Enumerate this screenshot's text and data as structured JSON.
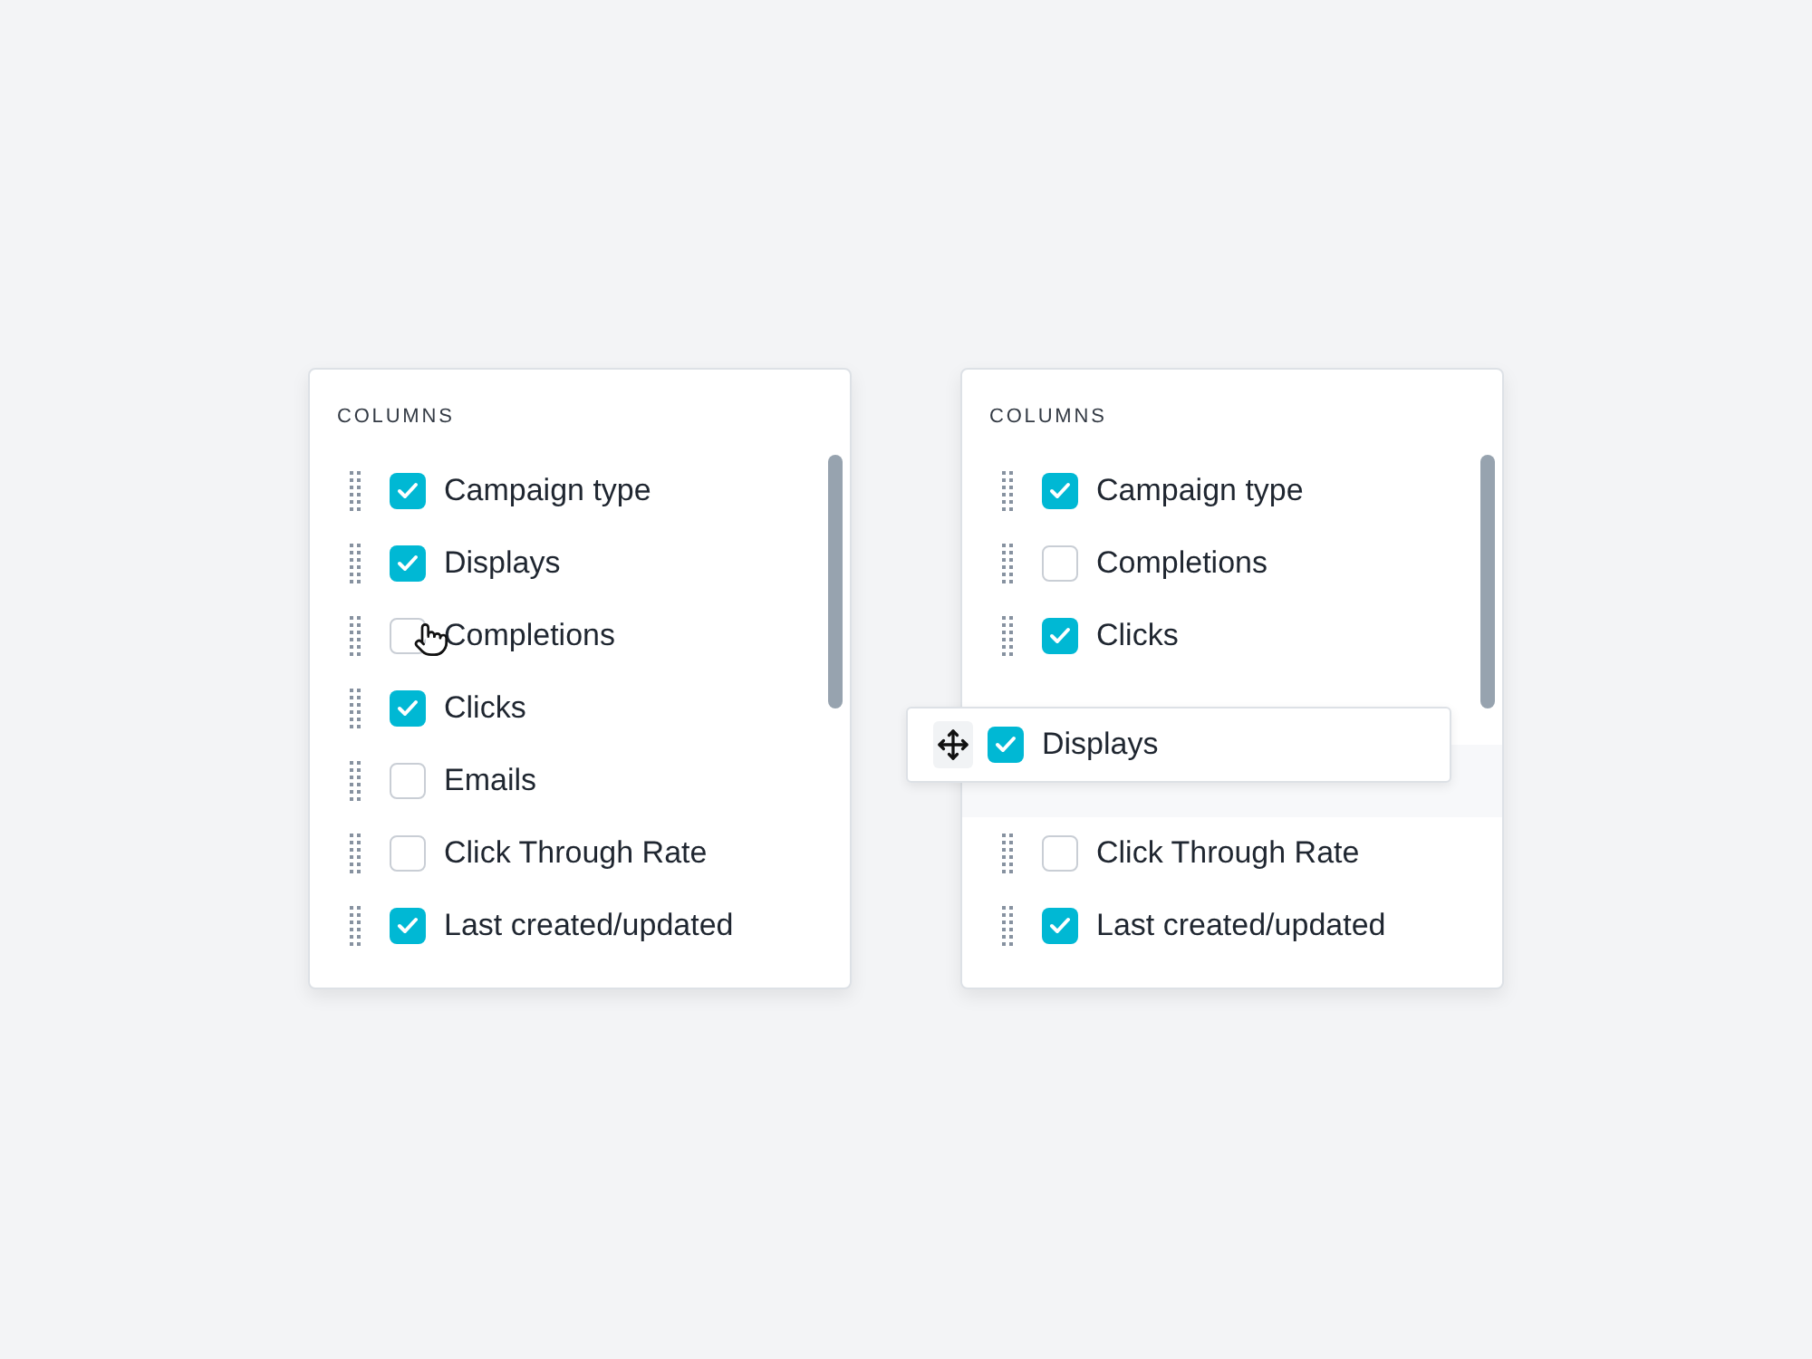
{
  "panels": [
    {
      "header": "COLUMNS",
      "items": [
        {
          "kind": "row",
          "label": "Campaign type",
          "checked": true,
          "pointer": false
        },
        {
          "kind": "row",
          "label": "Displays",
          "checked": true,
          "pointer": false
        },
        {
          "kind": "row",
          "label": "Completions",
          "checked": false,
          "pointer": true
        },
        {
          "kind": "row",
          "label": "Clicks",
          "checked": true,
          "pointer": false
        },
        {
          "kind": "row",
          "label": "Emails",
          "checked": false,
          "pointer": false
        },
        {
          "kind": "row",
          "label": "Click Through Rate",
          "checked": false,
          "pointer": false
        },
        {
          "kind": "row",
          "label": "Last created/updated",
          "checked": true,
          "pointer": false
        }
      ]
    },
    {
      "header": "COLUMNS",
      "items": [
        {
          "kind": "row",
          "label": "Campaign type",
          "checked": true,
          "pointer": false
        },
        {
          "kind": "row",
          "label": "Completions",
          "checked": false,
          "pointer": false
        },
        {
          "kind": "row",
          "label": "Clicks",
          "checked": true,
          "pointer": false
        },
        {
          "kind": "covered"
        },
        {
          "kind": "slot"
        },
        {
          "kind": "row",
          "label": "Click Through Rate",
          "checked": false,
          "pointer": false
        },
        {
          "kind": "row",
          "label": "Last created/updated",
          "checked": true,
          "pointer": false
        }
      ],
      "dragging": {
        "label": "Displays",
        "checked": true
      }
    }
  ]
}
